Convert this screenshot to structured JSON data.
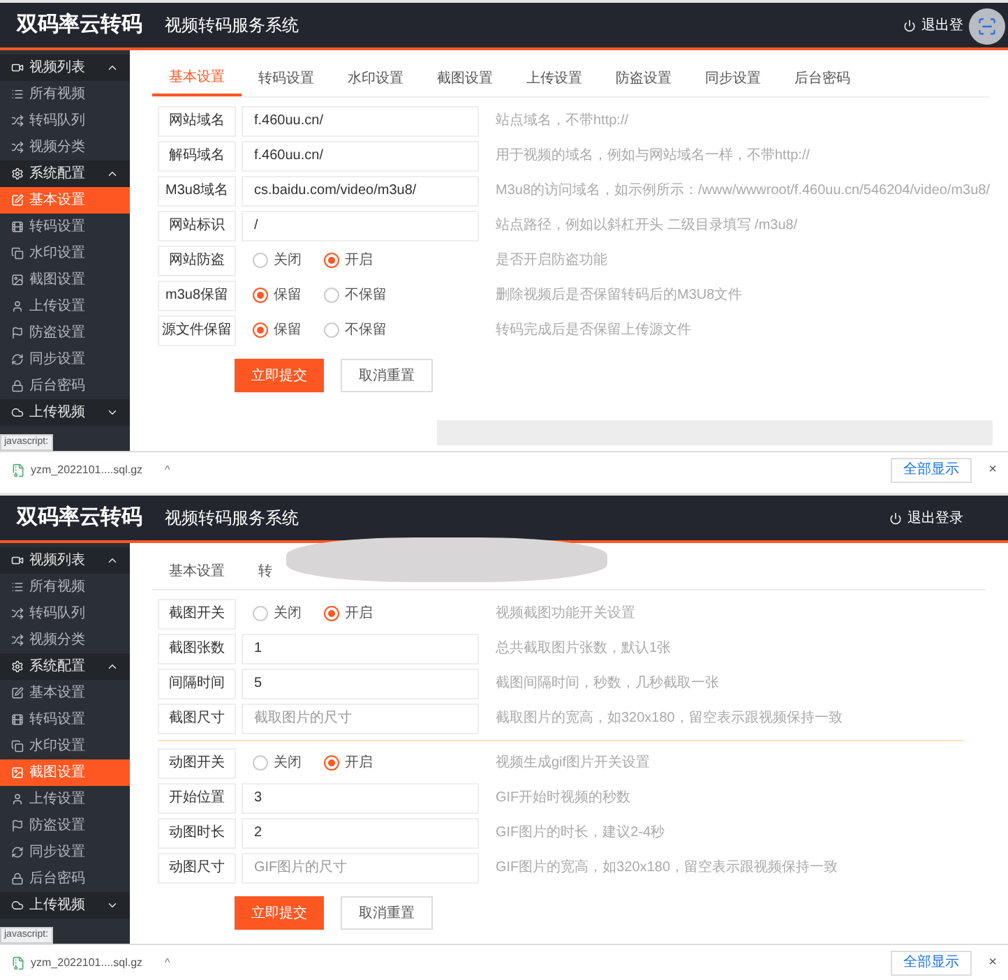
{
  "panels": [
    {
      "header": {
        "logo": "双码率云转码",
        "subtitle": "视频转码服务系统",
        "logout": "退出登"
      },
      "sidebar": [
        {
          "kind": "group",
          "label": "视频列表",
          "expanded": true
        },
        {
          "kind": "item",
          "label": "所有视频",
          "selected": false
        },
        {
          "kind": "item",
          "label": "转码队列",
          "selected": false
        },
        {
          "kind": "item",
          "label": "视频分类",
          "selected": false
        },
        {
          "kind": "group",
          "label": "系统配置",
          "expanded": true
        },
        {
          "kind": "item",
          "label": "基本设置",
          "selected": true
        },
        {
          "kind": "item",
          "label": "转码设置",
          "selected": false
        },
        {
          "kind": "item",
          "label": "水印设置",
          "selected": false
        },
        {
          "kind": "item",
          "label": "截图设置",
          "selected": false
        },
        {
          "kind": "item",
          "label": "上传设置",
          "selected": false
        },
        {
          "kind": "item",
          "label": "防盗设置",
          "selected": false
        },
        {
          "kind": "item",
          "label": "同步设置",
          "selected": false
        },
        {
          "kind": "item",
          "label": "后台密码",
          "selected": false
        },
        {
          "kind": "group",
          "label": "上传视频",
          "expanded": false
        }
      ],
      "tabs": [
        {
          "label": "基本设置",
          "selected": true
        },
        {
          "label": "转码设置",
          "selected": false
        },
        {
          "label": "水印设置",
          "selected": false
        },
        {
          "label": "截图设置",
          "selected": false
        },
        {
          "label": "上传设置",
          "selected": false
        },
        {
          "label": "防盗设置",
          "selected": false
        },
        {
          "label": "同步设置",
          "selected": false
        },
        {
          "label": "后台密码",
          "selected": false
        }
      ],
      "rows": [
        {
          "kind": "text",
          "label": "网站域名",
          "value": "f.460uu.cn/",
          "hint": "站点域名，不带http://"
        },
        {
          "kind": "text",
          "label": "解码域名",
          "value": "f.460uu.cn/",
          "hint": "用于视频的域名，例如与网站域名一样，不带http://"
        },
        {
          "kind": "text",
          "label": "M3u8域名",
          "value": "cs.baidu.com/video/m3u8/",
          "hint": "M3u8的访问域名，如示例所示：/www/wwwroot/f.460uu.cn/546204/video/m3u8/"
        },
        {
          "kind": "text",
          "label": "网站标识",
          "value": "/",
          "hint": "站点路径，例如以斜杠开头 二级目录填写 /m3u8/"
        },
        {
          "kind": "radio",
          "label": "网站防盗",
          "options": [
            {
              "label": "关闭",
              "selected": false
            },
            {
              "label": "开启",
              "selected": true
            }
          ],
          "hint": "是否开启防盗功能"
        },
        {
          "kind": "radio",
          "label": "m3u8保留",
          "options": [
            {
              "label": "保留",
              "selected": true
            },
            {
              "label": "不保留",
              "selected": false
            }
          ],
          "hint": "删除视频后是否保留转码后的M3U8文件"
        },
        {
          "kind": "radio",
          "label": "源文件保留",
          "options": [
            {
              "label": "保留",
              "selected": true
            },
            {
              "label": "不保留",
              "selected": false
            }
          ],
          "hint": "转码完成后是否保留上传源文件"
        }
      ],
      "buttons": [
        {
          "kind": "primary",
          "label": "立即提交"
        },
        {
          "kind": "secondary",
          "label": "取消重置"
        }
      ],
      "status": "javascript:",
      "download": "yzm_2022101....sql.gz",
      "download_caret": "^",
      "show_all": "全部显示",
      "close": "×"
    },
    {
      "header": {
        "logo": "双码率云转码",
        "subtitle": "视频转码服务系统",
        "logout": "退出登录"
      },
      "sidebar": [
        {
          "kind": "group",
          "label": "视频列表",
          "expanded": true
        },
        {
          "kind": "item",
          "label": "所有视频",
          "selected": false
        },
        {
          "kind": "item",
          "label": "转码队列",
          "selected": false
        },
        {
          "kind": "item",
          "label": "视频分类",
          "selected": false
        },
        {
          "kind": "group",
          "label": "系统配置",
          "expanded": true
        },
        {
          "kind": "item",
          "label": "基本设置",
          "selected": false
        },
        {
          "kind": "item",
          "label": "转码设置",
          "selected": false
        },
        {
          "kind": "item",
          "label": "水印设置",
          "selected": false
        },
        {
          "kind": "item",
          "label": "截图设置",
          "selected": true
        },
        {
          "kind": "item",
          "label": "上传设置",
          "selected": false
        },
        {
          "kind": "item",
          "label": "防盗设置",
          "selected": false
        },
        {
          "kind": "item",
          "label": "同步设置",
          "selected": false
        },
        {
          "kind": "item",
          "label": "后台密码",
          "selected": false
        },
        {
          "kind": "group",
          "label": "上传视频",
          "expanded": false
        }
      ],
      "tabs": [
        {
          "label": "基本设置",
          "selected": false
        },
        {
          "label": "转",
          "selected": false
        }
      ],
      "rows": [
        {
          "kind": "radio",
          "label": "截图开关",
          "options": [
            {
              "label": "关闭",
              "selected": false
            },
            {
              "label": "开启",
              "selected": true
            }
          ],
          "hint": "视频截图功能开关设置"
        },
        {
          "kind": "text",
          "label": "截图张数",
          "value": "1",
          "hint": "总共截取图片张数，默认1张"
        },
        {
          "kind": "text",
          "label": "间隔时间",
          "value": "5",
          "hint": "截图间隔时间，秒数，几秒截取一张"
        },
        {
          "kind": "text",
          "label": "截图尺寸",
          "placeholder": "截取图片的尺寸",
          "hint": "截取图片的宽高，如320x180，留空表示跟视频保持一致"
        },
        {
          "kind": "divider"
        },
        {
          "kind": "radio",
          "label": "动图开关",
          "options": [
            {
              "label": "关闭",
              "selected": false
            },
            {
              "label": "开启",
              "selected": true
            }
          ],
          "hint": "视频生成gif图片开关设置"
        },
        {
          "kind": "text",
          "label": "开始位置",
          "value": "3",
          "hint": "GIF开始时视频的秒数"
        },
        {
          "kind": "text",
          "label": "动图时长",
          "value": "2",
          "hint": "GIF图片的时长，建议2-4秒"
        },
        {
          "kind": "text",
          "label": "动图尺寸",
          "placeholder": "GIF图片的尺寸",
          "hint": "GIF图片的宽高，如320x180，留空表示跟视频保持一致"
        }
      ],
      "buttons": [
        {
          "kind": "primary",
          "label": "立即提交"
        },
        {
          "kind": "secondary",
          "label": "取消重置"
        }
      ],
      "status": "javascript:",
      "download": "yzm_2022101....sql.gz",
      "download_caret": "^",
      "show_all": "全部显示",
      "close": "×"
    }
  ]
}
